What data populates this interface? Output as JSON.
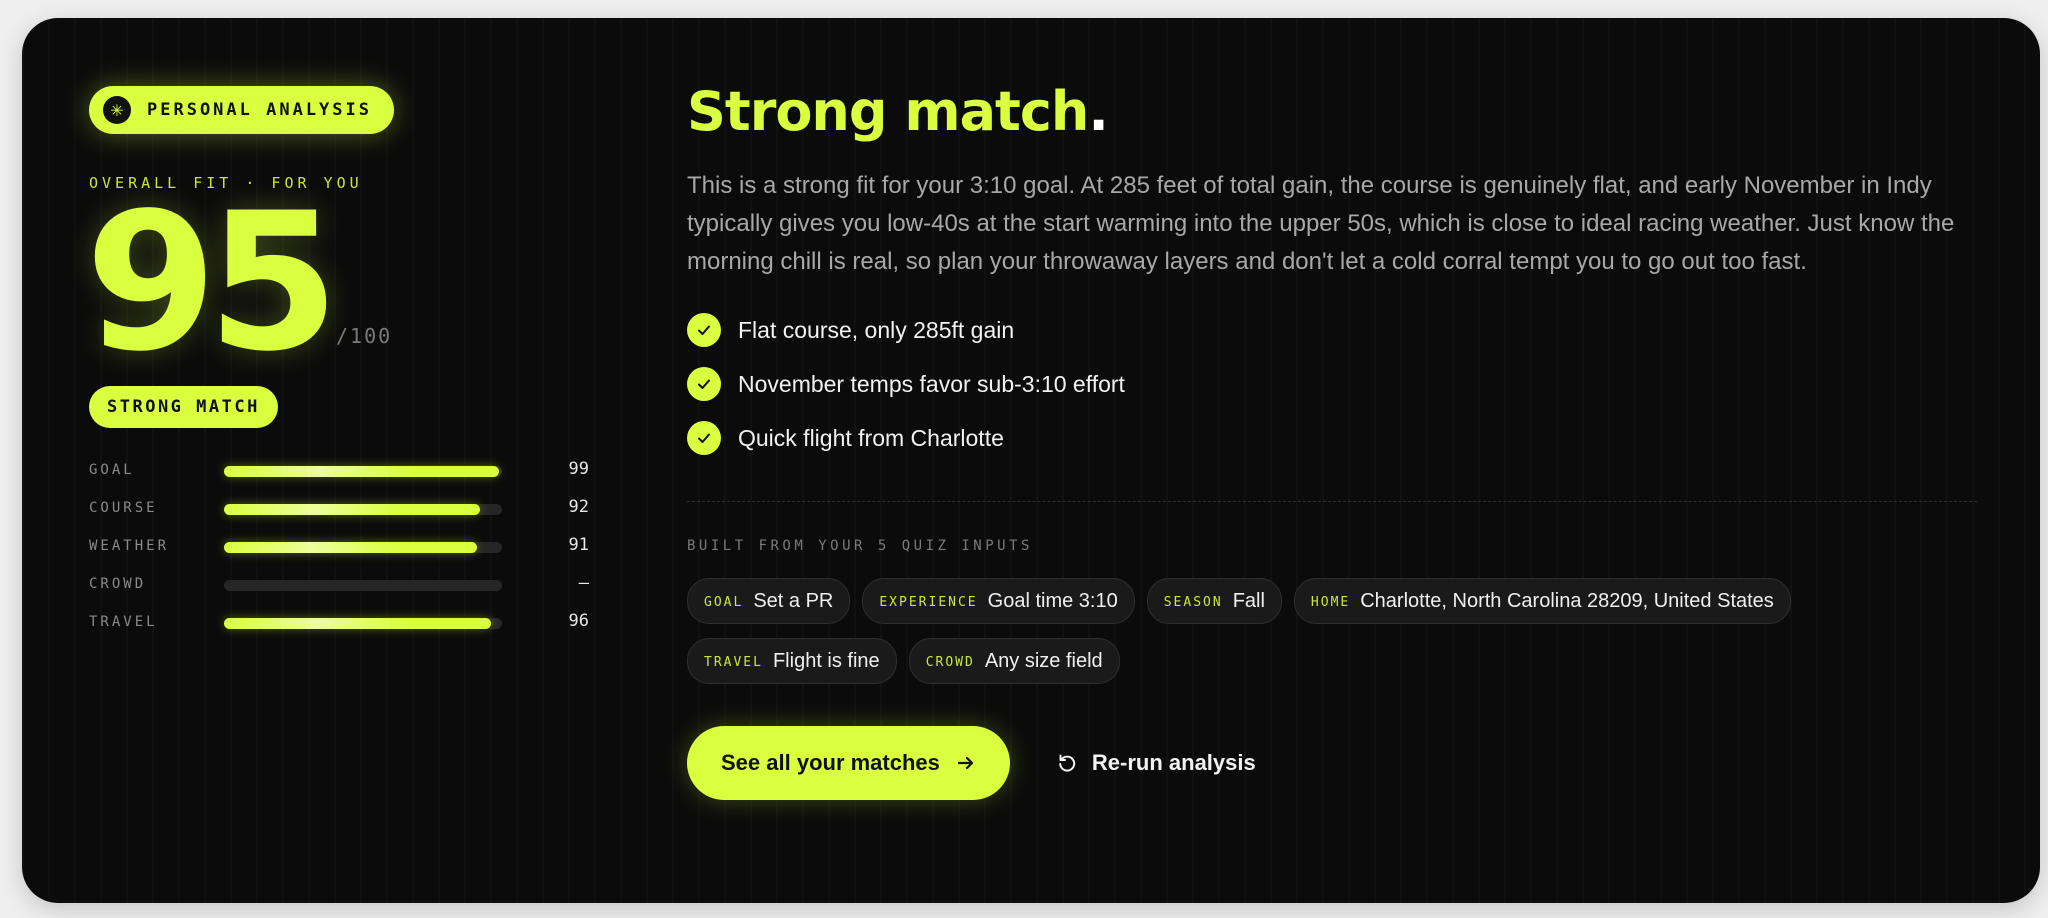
{
  "badge": {
    "label": "PERSONAL ANALYSIS",
    "icon": "sparkle-icon"
  },
  "overall_label": "OVERALL FIT · FOR YOU",
  "score": {
    "value": "95",
    "out_of": "/100"
  },
  "match_pill": "STRONG MATCH",
  "breakdown": [
    {
      "label": "GOAL",
      "value": "99",
      "fraction": 0.99
    },
    {
      "label": "COURSE",
      "value": "92",
      "fraction": 0.92
    },
    {
      "label": "WEATHER",
      "value": "91",
      "fraction": 0.91
    },
    {
      "label": "CROWD",
      "value": "—",
      "fraction": 0
    },
    {
      "label": "TRAVEL",
      "value": "96",
      "fraction": 0.96
    }
  ],
  "headline": {
    "text": "Strong match",
    "period": "."
  },
  "body": "This is a strong fit for your 3:10 goal. At 285 feet of total gain, the course is genuinely flat, and early November in Indy typically gives you low-40s at the start warming into the upper 50s, which is close to ideal racing weather. Just know the morning chill is real, so plan your throwaway layers and don't let a cold corral tempt you to go out too fast.",
  "highlights": [
    "Flat course, only 285ft gain",
    "November temps favor sub-3:10 effort",
    "Quick flight from Charlotte"
  ],
  "inputs_label": "BUILT FROM YOUR 5 QUIZ INPUTS",
  "inputs": [
    {
      "key": "GOAL",
      "value": "Set a PR"
    },
    {
      "key": "EXPERIENCE",
      "value": "Goal time 3:10"
    },
    {
      "key": "SEASON",
      "value": "Fall"
    },
    {
      "key": "HOME",
      "value": "Charlotte, North Carolina 28209, United States"
    },
    {
      "key": "TRAVEL",
      "value": "Flight is fine"
    },
    {
      "key": "CROWD",
      "value": "Any size field"
    }
  ],
  "actions": {
    "primary_label": "See all your matches",
    "secondary_label": "Re-run analysis"
  },
  "colors": {
    "accent": "#d9ff3f",
    "background": "#0b0b0b"
  }
}
